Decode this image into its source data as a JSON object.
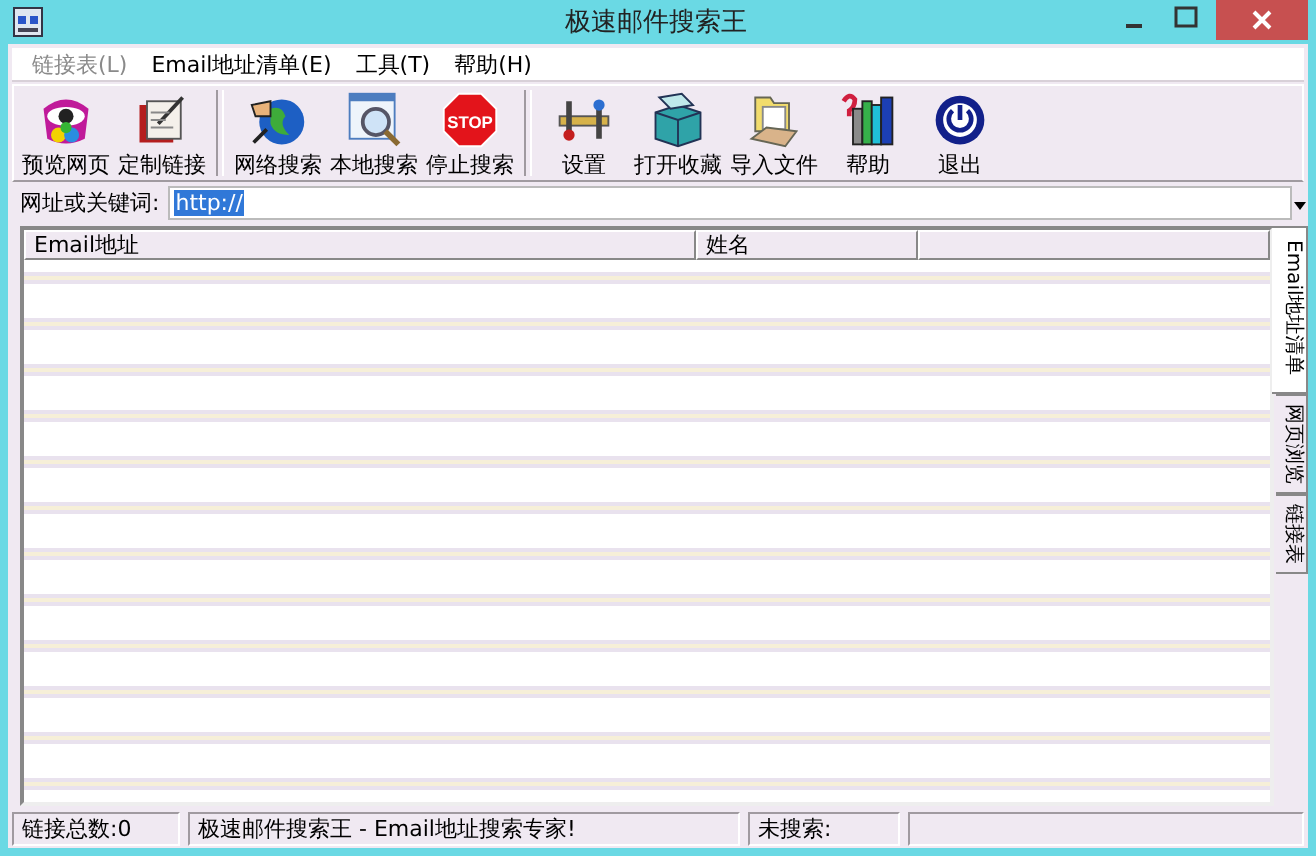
{
  "window": {
    "title": "极速邮件搜索王"
  },
  "menu": [
    {
      "label": "链接表(L)",
      "disabled": true
    },
    {
      "label": "Email地址清单(E)",
      "disabled": false
    },
    {
      "label": "工具(T)",
      "disabled": false
    },
    {
      "label": "帮助(H)",
      "disabled": false
    }
  ],
  "toolbar": [
    [
      {
        "label": "预览网页",
        "kind": "eye"
      },
      {
        "label": "定制链接",
        "kind": "book"
      }
    ],
    [
      {
        "label": "网络搜索",
        "kind": "globe"
      },
      {
        "label": "本地搜索",
        "kind": "magnifier"
      },
      {
        "label": "停止搜索",
        "kind": "stop",
        "icon_text": "STOP"
      }
    ],
    [
      {
        "label": "设置",
        "kind": "tools"
      },
      {
        "label": "打开收藏",
        "kind": "box"
      },
      {
        "label": "导入文件",
        "kind": "folder"
      },
      {
        "label": "帮助",
        "kind": "books"
      },
      {
        "label": "退出",
        "kind": "power"
      }
    ]
  ],
  "address": {
    "label": "网址或关键词:",
    "value": "http://"
  },
  "table": {
    "columns": [
      "Email地址",
      "姓名"
    ]
  },
  "side_tabs": [
    {
      "label": "Email地址清单",
      "selected": true
    },
    {
      "label": "网页浏览",
      "selected": false
    },
    {
      "label": "链接表",
      "selected": false
    }
  ],
  "status_bar": [
    "链接总数:0",
    "极速邮件搜索王 - Email地址搜索专家!",
    "未搜索:"
  ]
}
